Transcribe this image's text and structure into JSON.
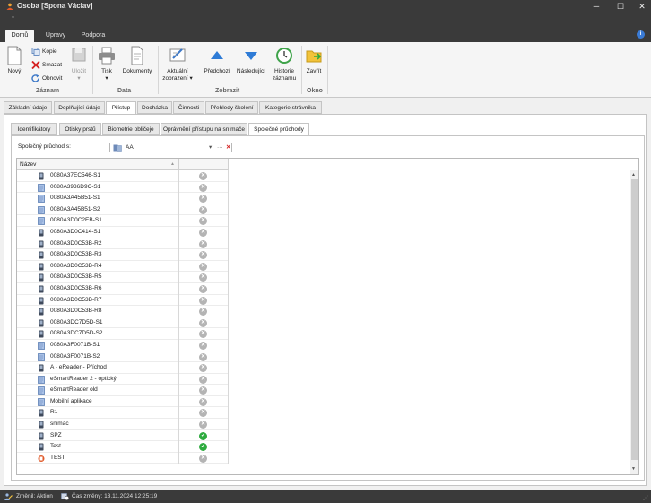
{
  "window": {
    "title": "Osoba [Spona Václav]",
    "qat_glyph": "⌄",
    "minimize_glyph": "─",
    "maximize_glyph": "☐",
    "close_glyph": "✕"
  },
  "ribbon_tabs": [
    {
      "label": "Domů",
      "active": true
    },
    {
      "label": "Úpravy",
      "active": false
    },
    {
      "label": "Podpora",
      "active": false
    }
  ],
  "help_glyph": "i",
  "ribbon": {
    "groups": {
      "zaznam": "Záznam",
      "data": "Data",
      "zobrazit": "Zobrazit",
      "okno": "Okno"
    },
    "buttons": {
      "novy": "Nový",
      "kopie": "Kopie",
      "smazat": "Smazat",
      "obnovit": "Obnovit",
      "ulozit": "Uložit",
      "tisk": "Tisk",
      "dokumenty": "Dokumenty",
      "aktualni1": "Aktuální",
      "aktualni2": "zobrazení",
      "predchozi": "Předchozí",
      "nasledujici": "Následující",
      "historie1": "Historie",
      "historie2": "záznamu",
      "zavrit": "Zavřít"
    },
    "dropdown_glyph": "▾"
  },
  "main_tabs": [
    {
      "label": "Základní údaje",
      "active": false
    },
    {
      "label": "Doplňující údaje",
      "active": false
    },
    {
      "label": "Přístup",
      "active": true
    },
    {
      "label": "Docházka",
      "active": false
    },
    {
      "label": "Činnosti",
      "active": false
    },
    {
      "label": "Přehledy školení",
      "active": false
    },
    {
      "label": "Kategorie strávníka",
      "active": false
    }
  ],
  "sub_tabs": [
    {
      "label": "Identifikátory",
      "active": false
    },
    {
      "label": "Otisky prstů",
      "active": false
    },
    {
      "label": "Biometrie obličeje",
      "active": false
    },
    {
      "label": "Oprávnění přístupu na snímače",
      "active": false
    },
    {
      "label": "Společné průchody",
      "active": true
    }
  ],
  "shared_passage": {
    "label": "Společný průchod s:",
    "value": "AA",
    "dropdown_glyph": "▾",
    "more_glyph": "···",
    "clear_glyph": "✕"
  },
  "grid": {
    "header_name": "Název",
    "sort_glyph": "▲",
    "rows": [
      {
        "name": "0080A37EC546-S1",
        "icon": "phone",
        "allowed": false
      },
      {
        "name": "0080A3936D9C-S1",
        "icon": "panel",
        "allowed": false
      },
      {
        "name": "0080A3A45B51-S1",
        "icon": "panel",
        "allowed": false
      },
      {
        "name": "0080A3A45B51-S2",
        "icon": "panel",
        "allowed": false
      },
      {
        "name": "0080A3D0C2EB-S1",
        "icon": "panel",
        "allowed": false
      },
      {
        "name": "0080A3D0C414-S1",
        "icon": "phone",
        "allowed": false
      },
      {
        "name": "0080A3D0C53B-R2",
        "icon": "phone",
        "allowed": false
      },
      {
        "name": "0080A3D0C53B-R3",
        "icon": "phone",
        "allowed": false
      },
      {
        "name": "0080A3D0C53B-R4",
        "icon": "phone",
        "allowed": false
      },
      {
        "name": "0080A3D0C53B-R5",
        "icon": "phone",
        "allowed": false
      },
      {
        "name": "0080A3D0C53B-R6",
        "icon": "phone",
        "allowed": false
      },
      {
        "name": "0080A3D0C53B-R7",
        "icon": "phone",
        "allowed": false
      },
      {
        "name": "0080A3D0C53B-R8",
        "icon": "phone",
        "allowed": false
      },
      {
        "name": "0080A3DC7D5D-S1",
        "icon": "phone",
        "allowed": false
      },
      {
        "name": "0080A3DC7D5D-S2",
        "icon": "phone",
        "allowed": false
      },
      {
        "name": "0080A3F0071B-S1",
        "icon": "panel",
        "allowed": false
      },
      {
        "name": "0080A3F0071B-S2",
        "icon": "panel",
        "allowed": false
      },
      {
        "name": "A - eReader - Příchod",
        "icon": "phone",
        "allowed": false
      },
      {
        "name": "eSmartReader 2 - optický",
        "icon": "panel",
        "allowed": false
      },
      {
        "name": "eSmartReader old",
        "icon": "panel",
        "allowed": false
      },
      {
        "name": "Mobilní aplikace",
        "icon": "panel",
        "allowed": false
      },
      {
        "name": "R1",
        "icon": "phone",
        "allowed": false
      },
      {
        "name": "snimac",
        "icon": "phone",
        "allowed": false
      },
      {
        "name": "SPZ",
        "icon": "phone",
        "allowed": true
      },
      {
        "name": "Test",
        "icon": "phone",
        "allowed": true
      },
      {
        "name": "TEST",
        "icon": "special",
        "allowed": false
      }
    ],
    "no_glyph": "✕",
    "yes_glyph": "✓",
    "scroll_up_glyph": "▲",
    "scroll_down_glyph": "▼"
  },
  "status": {
    "changed_by": "Změnil: Aktion",
    "changed_at": "Čas změny: 13.11.2024 12:25:19"
  }
}
